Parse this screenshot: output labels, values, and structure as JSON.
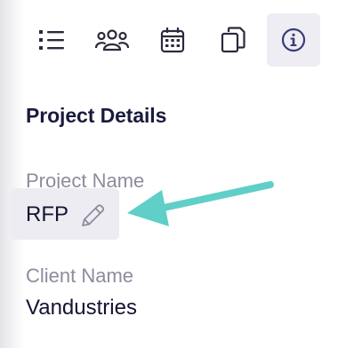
{
  "toolbar": {
    "items": [
      {
        "icon": "list-icon",
        "active": false
      },
      {
        "icon": "team-icon",
        "active": false
      },
      {
        "icon": "calendar-icon",
        "active": false
      },
      {
        "icon": "copy-icon",
        "active": false
      },
      {
        "icon": "info-icon",
        "active": true
      }
    ],
    "icon_color": "#2a2a3e",
    "active_icon_color": "#3b3b78",
    "active_bg": "#ededf3"
  },
  "section": {
    "title": "Project Details"
  },
  "fields": [
    {
      "label": "Project Name",
      "value": "RFP",
      "editable": true
    },
    {
      "label": "Client Name",
      "value": "Vandustries",
      "editable": false
    }
  ],
  "annotation": {
    "type": "arrow",
    "color": "#5fcfc7"
  }
}
